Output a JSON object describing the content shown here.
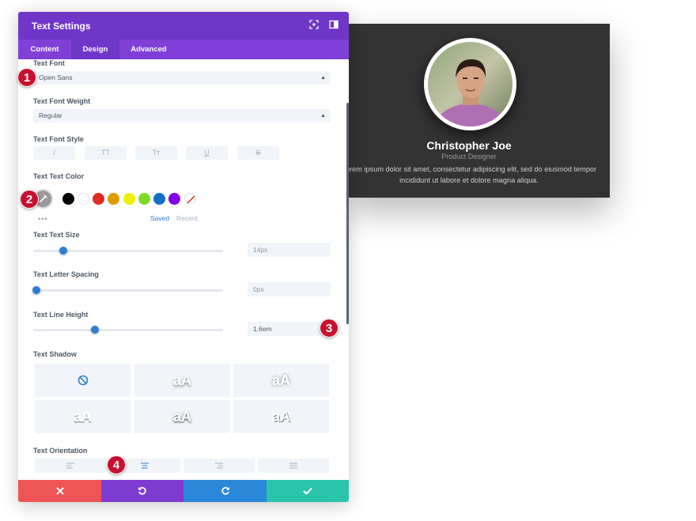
{
  "preview": {
    "name": "Christopher Joe",
    "role": "Product Designer",
    "body": "Lorem ipsum dolor sit amet, consectetur adipiscing elit, sed do eiusmod tempor incididunt ut labore et dolore magna aliqua."
  },
  "panel": {
    "title": "Text Settings",
    "tabs": [
      "Content",
      "Design",
      "Advanced"
    ],
    "active_tab": "Design"
  },
  "fields": {
    "font_label": "Text Font",
    "font_value": "Open Sans",
    "weight_label": "Text Font Weight",
    "weight_value": "Regular",
    "style_label": "Text Font Style",
    "style_buttons": [
      "I",
      "TT",
      "Tт",
      "U",
      "S"
    ],
    "color_label": "Text Text Color",
    "colors": [
      "#000000",
      "#ffffff",
      "#e02b20",
      "#e09900",
      "#edf000",
      "#7cda24",
      "#0c71c3",
      "#8300e9"
    ],
    "saved_label": "Saved",
    "recent_label": "Recent",
    "size_label": "Text Text Size",
    "size_value": "14px",
    "size_level": 0.14,
    "spacing_label": "Text Letter Spacing",
    "spacing_value": "0px",
    "spacing_level": 0.0,
    "line_label": "Text Line Height",
    "line_value": "1.6em",
    "line_level": 0.31,
    "shadow_label": "Text Shadow",
    "shadow_sample": "aA",
    "orientation_label": "Text Orientation"
  },
  "markers": [
    "1",
    "2",
    "3",
    "4"
  ],
  "footer": {
    "colors": [
      "#ef5555",
      "#7e3bd0",
      "#2b87da",
      "#29c4a9"
    ]
  }
}
